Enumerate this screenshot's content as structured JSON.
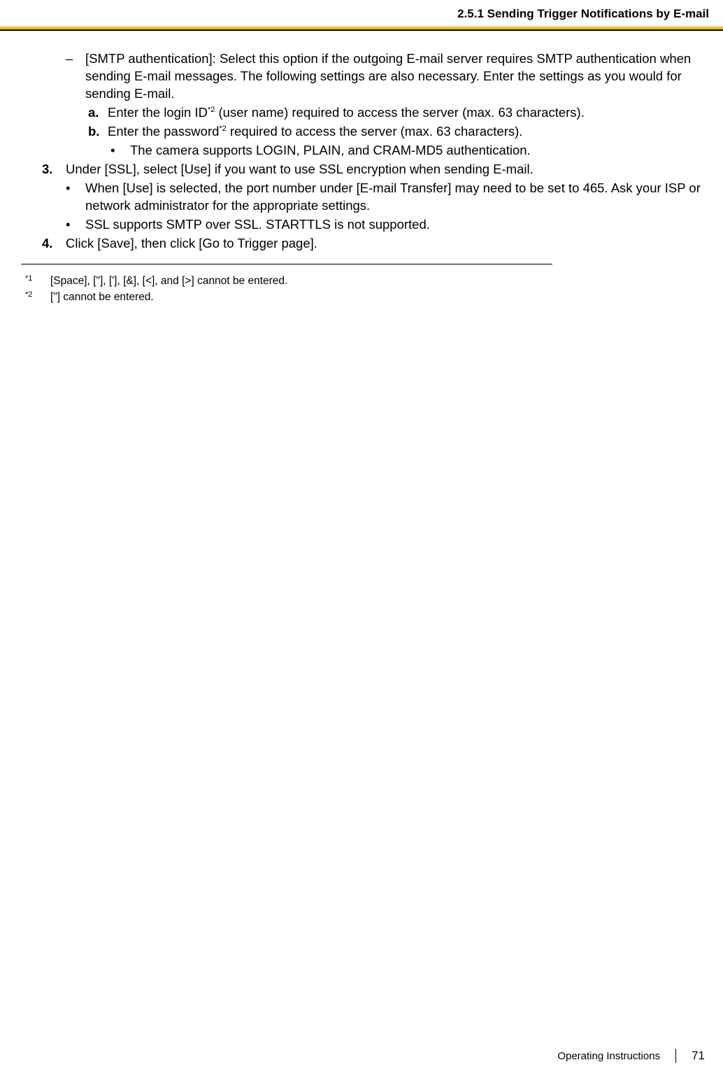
{
  "header": {
    "section_title": "2.5.1 Sending Trigger Notifications by E-mail"
  },
  "body": {
    "smtp_dash_pre": "[SMTP authentication]: Select this option if the outgoing E-mail server requires SMTP authentication when sending E-mail messages. The following settings are also necessary. Enter the settings as you would for sending E-mail.",
    "a_label": "a.",
    "a_pre": "Enter the login ID",
    "a_sup": "*2",
    "a_post": " (user name) required to access the server (max. 63 characters).",
    "b_label": "b.",
    "b_pre": "Enter the password",
    "b_sup": "*2",
    "b_post": " required to access the server (max. 63 characters).",
    "b_sub_bullet": "The camera supports LOGIN, PLAIN, and CRAM-MD5 authentication.",
    "s3_label": "3.",
    "s3_text": "Under [SSL], select [Use] if you want to use SSL encryption when sending E-mail.",
    "s3_b1": "When [Use] is selected, the port number under [E-mail Transfer] may need to be set to 465. Ask your ISP or network administrator for the appropriate settings.",
    "s3_b2": "SSL supports SMTP over SSL. STARTTLS is not supported.",
    "s4_label": "4.",
    "s4_text": "Click [Save], then click [Go to Trigger page]."
  },
  "footnotes": {
    "f1_marker": "*1",
    "f1_text": "[Space], [\"], ['], [&], [<], and [>] cannot be entered.",
    "f2_marker": "*2",
    "f2_text": "[\"] cannot be entered."
  },
  "footer": {
    "doc_title": "Operating Instructions",
    "page": "71"
  }
}
